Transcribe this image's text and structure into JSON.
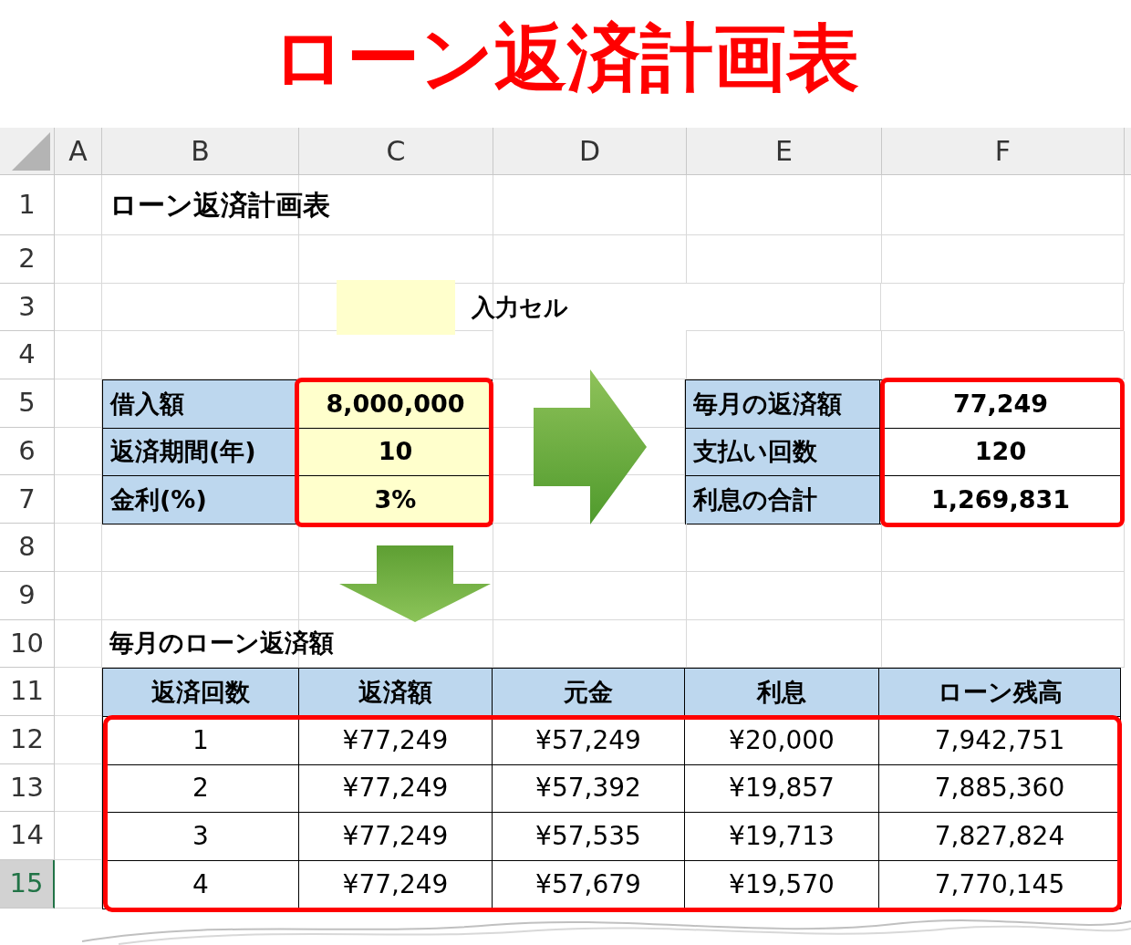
{
  "title": "ローン返済計画表",
  "sheet": {
    "column_headers": [
      "A",
      "B",
      "C",
      "D",
      "E",
      "F"
    ],
    "row_numbers": [
      {
        "label": "1",
        "selected": false
      },
      {
        "label": "2",
        "selected": false
      },
      {
        "label": "3",
        "selected": false
      },
      {
        "label": "4",
        "selected": false
      },
      {
        "label": "5",
        "selected": false
      },
      {
        "label": "6",
        "selected": false
      },
      {
        "label": "7",
        "selected": false
      },
      {
        "label": "8",
        "selected": false
      },
      {
        "label": "9",
        "selected": false
      },
      {
        "label": "10",
        "selected": false
      },
      {
        "label": "11",
        "selected": false
      },
      {
        "label": "12",
        "selected": false
      },
      {
        "label": "13",
        "selected": false
      },
      {
        "label": "14",
        "selected": false
      },
      {
        "label": "15",
        "selected": true
      }
    ],
    "sheet_title": "ローン返済計画表",
    "legend": {
      "label": "入力セル"
    },
    "inputs": [
      {
        "label": "借入額",
        "value": "8,000,000"
      },
      {
        "label": "返済期間(年)",
        "value": "10"
      },
      {
        "label": "金利(%)",
        "value": "3%"
      }
    ],
    "outputs": [
      {
        "label": "毎月の返済額",
        "value": "77,249"
      },
      {
        "label": "支払い回数",
        "value": "120"
      },
      {
        "label": "利息の合計",
        "value": "1,269,831"
      }
    ],
    "schedule_title": "毎月のローン返済額",
    "schedule": {
      "columns": [
        "返済回数",
        "返済額",
        "元金",
        "利息",
        "ローン残高"
      ],
      "rows": [
        [
          "1",
          "¥77,249",
          "¥57,249",
          "¥20,000",
          "7,942,751"
        ],
        [
          "2",
          "¥77,249",
          "¥57,392",
          "¥19,857",
          "7,885,360"
        ],
        [
          "3",
          "¥77,249",
          "¥57,535",
          "¥19,713",
          "7,827,824"
        ],
        [
          "4",
          "¥77,249",
          "¥57,679",
          "¥19,570",
          "7,770,145"
        ]
      ]
    }
  }
}
